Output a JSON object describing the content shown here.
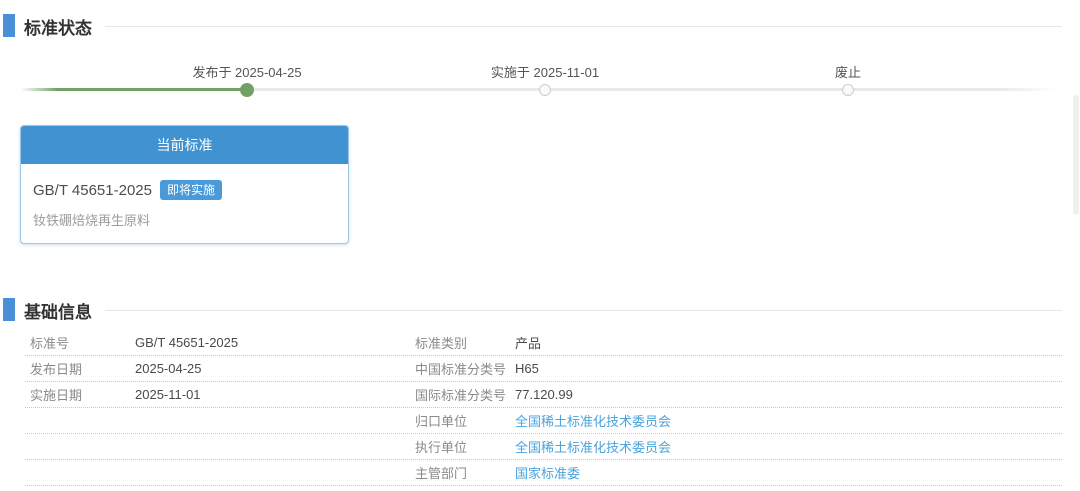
{
  "colors": {
    "accent_blue": "#4192d0",
    "badge_blue": "#4a9ad9",
    "link_blue": "#4aa3dd",
    "timeline_green": "#71a165",
    "timeline_gray": "#e9e9e9",
    "label_gray": "#8a8a8a",
    "value_gray": "#4a4a4a"
  },
  "status_section": {
    "title": "标准状态",
    "timeline": [
      {
        "label": "发布于 2025-04-25",
        "state": "done"
      },
      {
        "label": "实施于 2025-11-01",
        "state": "pending"
      },
      {
        "label": "废止",
        "state": "pending"
      }
    ],
    "card": {
      "header": "当前标准",
      "code": "GB/T 45651-2025",
      "badge": "即将实施",
      "name": "钕铁硼焙烧再生原料"
    }
  },
  "info_section": {
    "title": "基础信息",
    "rows": [
      {
        "left_label": "标准号",
        "left_value": "GB/T 45651-2025",
        "right_label": "标准类别",
        "right_value": "产品"
      },
      {
        "left_label": "发布日期",
        "left_value": "2025-04-25",
        "right_label": "中国标准分类号",
        "right_value": "H65"
      },
      {
        "left_label": "实施日期",
        "left_value": "2025-11-01",
        "right_label": "国际标准分类号",
        "right_value": "77.120.99"
      },
      {
        "left_label": "",
        "left_value": "",
        "right_label": "归口单位",
        "right_value": "全国稀土标准化技术委员会"
      },
      {
        "left_label": "",
        "left_value": "",
        "right_label": "执行单位",
        "right_value": "全国稀土标准化技术委员会"
      },
      {
        "left_label": "",
        "left_value": "",
        "right_label": "主管部门",
        "right_value": "国家标准委"
      }
    ]
  }
}
